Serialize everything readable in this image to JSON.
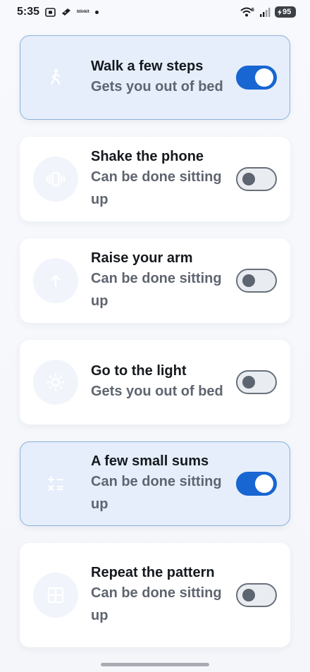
{
  "status_bar": {
    "time": "5:35",
    "app_label": "blinkit",
    "network_label": "5",
    "battery_level": "95",
    "icons": [
      "screenshot-icon",
      "delivery-icon",
      "notification-dot",
      "wifi-icon",
      "signal-icon",
      "battery-icon"
    ]
  },
  "tasks": [
    {
      "title": "Walk a few steps",
      "subtitle": "Gets you out of bed",
      "enabled": true,
      "icon": "walk-icon"
    },
    {
      "title": "Shake the phone",
      "subtitle": "Can be done sitting up",
      "enabled": false,
      "icon": "vibrate-icon"
    },
    {
      "title": "Raise your arm",
      "subtitle": "Can be done sitting up",
      "enabled": false,
      "icon": "arrow-up-icon"
    },
    {
      "title": "Go to the light",
      "subtitle": "Gets you out of bed",
      "enabled": false,
      "icon": "sun-icon"
    },
    {
      "title": "A few small sums",
      "subtitle": "Can be done sitting up",
      "enabled": true,
      "icon": "calculator-icon"
    },
    {
      "title": "Repeat the pattern",
      "subtitle": "Can be done sitting up",
      "enabled": false,
      "icon": "grid-icon"
    }
  ],
  "colors": {
    "accent": "#1766d1",
    "selected_card": "#e6eefb",
    "selected_border": "#8cb1d8",
    "subtitle": "#5f6570",
    "icon_tint": "#ffffff"
  }
}
